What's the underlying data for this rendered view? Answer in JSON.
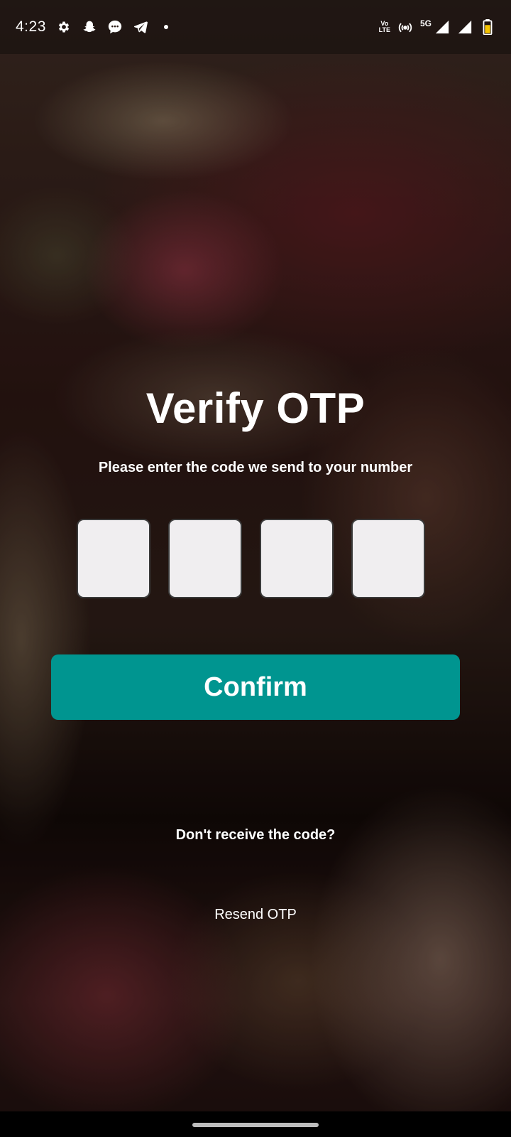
{
  "status_bar": {
    "time": "4:23",
    "left_icons": [
      "gear-icon",
      "snapchat-icon",
      "chat-bubble-icon",
      "telegram-icon",
      "dot-icon"
    ],
    "volte_top": "Vo",
    "volte_bottom": "LTE",
    "network": "5G",
    "right_icons": [
      "hotspot-icon",
      "signal-icon",
      "signal-icon",
      "battery-icon"
    ]
  },
  "screen": {
    "title": "Verify OTP",
    "subtitle": "Please enter the code we send to your number",
    "otp_boxes": [
      "",
      "",
      "",
      ""
    ],
    "confirm_label": "Confirm",
    "no_code_text": "Don't receive the code?",
    "resend_label": "Resend OTP"
  },
  "colors": {
    "confirm_button": "#009590",
    "otp_box_fill": "#f0eef0",
    "text": "#ffffff"
  }
}
